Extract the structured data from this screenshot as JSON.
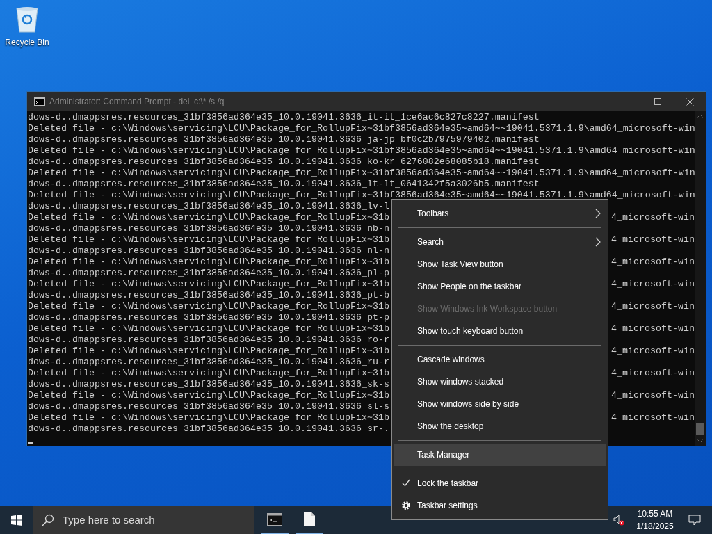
{
  "desktop_icons": [
    {
      "label": "Recycle Bin"
    }
  ],
  "window": {
    "title": "Administrator: Command Prompt - del  c:\\* /s /q",
    "active": false,
    "lines": [
      {
        "text": "dows-d..dmappsres.resources_31bf3856ad364e35_10.0.19041.3636_it-it_1ce6ac6c827c8227.manifest"
      },
      {
        "text": "Deleted file - c:\\Windows\\servicing\\LCU\\Package_for_RollupFix~31bf3856ad364e35~amd64~~19041.5371.1.9\\amd64_microsoft-win"
      },
      {
        "text": "dows-d..dmappsres.resources_31bf3856ad364e35_10.0.19041.3636_ja-jp_bf0c2b7975979402.manifest"
      },
      {
        "text": "Deleted file - c:\\Windows\\servicing\\LCU\\Package_for_RollupFix~31bf3856ad364e35~amd64~~19041.5371.1.9\\amd64_microsoft-win"
      },
      {
        "text": "dows-d..dmappsres.resources_31bf3856ad364e35_10.0.19041.3636_ko-kr_6276082e68085b18.manifest"
      },
      {
        "text": "Deleted file - c:\\Windows\\servicing\\LCU\\Package_for_RollupFix~31bf3856ad364e35~amd64~~19041.5371.1.9\\amd64_microsoft-win"
      },
      {
        "text": "dows-d..dmappsres.resources_31bf3856ad364e35_10.0.19041.3636_lt-lt_0641342f5a3026b5.manifest"
      },
      {
        "text": "Deleted file - c:\\Windows\\servicing\\LCU\\Package_for_RollupFix~31bf3856ad364e35~amd64~~19041.5371.1.9\\amd64_microsoft-win"
      },
      {
        "text": "dows-d..dmappsres.resources_31bf3856ad364e35_10.0.19041.3636_lv-l"
      },
      {
        "text": "Deleted file - c:\\Windows\\servicing\\LCU\\Package_for_RollupFix~31b",
        "tail": "4_microsoft-win"
      },
      {
        "text": "dows-d..dmappsres.resources_31bf3856ad364e35_10.0.19041.3636_nb-n"
      },
      {
        "text": "Deleted file - c:\\Windows\\servicing\\LCU\\Package_for_RollupFix~31b",
        "tail": "4_microsoft-win"
      },
      {
        "text": "dows-d..dmappsres.resources_31bf3856ad364e35_10.0.19041.3636_nl-n"
      },
      {
        "text": "Deleted file - c:\\Windows\\servicing\\LCU\\Package_for_RollupFix~31b",
        "tail": "4_microsoft-win"
      },
      {
        "text": "dows-d..dmappsres.resources_31bf3856ad364e35_10.0.19041.3636_pl-p"
      },
      {
        "text": "Deleted file - c:\\Windows\\servicing\\LCU\\Package_for_RollupFix~31b",
        "tail": "4_microsoft-win"
      },
      {
        "text": "dows-d..dmappsres.resources_31bf3856ad364e35_10.0.19041.3636_pt-b"
      },
      {
        "text": "Deleted file - c:\\Windows\\servicing\\LCU\\Package_for_RollupFix~31b",
        "tail": "4_microsoft-win"
      },
      {
        "text": "dows-d..dmappsres.resources_31bf3856ad364e35_10.0.19041.3636_pt-p"
      },
      {
        "text": "Deleted file - c:\\Windows\\servicing\\LCU\\Package_for_RollupFix~31b",
        "tail": "4_microsoft-win"
      },
      {
        "text": "dows-d..dmappsres.resources_31bf3856ad364e35_10.0.19041.3636_ro-r"
      },
      {
        "text": "Deleted file - c:\\Windows\\servicing\\LCU\\Package_for_RollupFix~31b",
        "tail": "4_microsoft-win"
      },
      {
        "text": "dows-d..dmappsres.resources_31bf3856ad364e35_10.0.19041.3636_ru-r"
      },
      {
        "text": "Deleted file - c:\\Windows\\servicing\\LCU\\Package_for_RollupFix~31b",
        "tail": "4_microsoft-win"
      },
      {
        "text": "dows-d..dmappsres.resources_31bf3856ad364e35_10.0.19041.3636_sk-s"
      },
      {
        "text": "Deleted file - c:\\Windows\\servicing\\LCU\\Package_for_RollupFix~31b",
        "tail": "4_microsoft-win"
      },
      {
        "text": "dows-d..dmappsres.resources_31bf3856ad364e35_10.0.19041.3636_sl-s"
      },
      {
        "text": "Deleted file - c:\\Windows\\servicing\\LCU\\Package_for_RollupFix~31b",
        "tail": "4_microsoft-win"
      },
      {
        "text": "dows-d..dmappsres.resources_31bf3856ad364e35_10.0.19041.3636_sr-."
      }
    ]
  },
  "context_menu": {
    "items": [
      {
        "kind": "item",
        "label": "Toolbars",
        "submenu": true,
        "disabled": false,
        "selected": false,
        "checked": false
      },
      {
        "kind": "separator"
      },
      {
        "kind": "item",
        "label": "Search",
        "submenu": true,
        "disabled": false,
        "selected": false,
        "checked": false
      },
      {
        "kind": "item",
        "label": "Show Task View button",
        "submenu": false,
        "disabled": false,
        "selected": false,
        "checked": false
      },
      {
        "kind": "item",
        "label": "Show People on the taskbar",
        "submenu": false,
        "disabled": false,
        "selected": false,
        "checked": false
      },
      {
        "kind": "item",
        "label": "Show Windows Ink Workspace button",
        "submenu": false,
        "disabled": true,
        "selected": false,
        "checked": false
      },
      {
        "kind": "item",
        "label": "Show touch keyboard button",
        "submenu": false,
        "disabled": false,
        "selected": false,
        "checked": false
      },
      {
        "kind": "separator"
      },
      {
        "kind": "item",
        "label": "Cascade windows",
        "submenu": false,
        "disabled": false,
        "selected": false,
        "checked": false
      },
      {
        "kind": "item",
        "label": "Show windows stacked",
        "submenu": false,
        "disabled": false,
        "selected": false,
        "checked": false
      },
      {
        "kind": "item",
        "label": "Show windows side by side",
        "submenu": false,
        "disabled": false,
        "selected": false,
        "checked": false
      },
      {
        "kind": "item",
        "label": "Show the desktop",
        "submenu": false,
        "disabled": false,
        "selected": false,
        "checked": false
      },
      {
        "kind": "separator"
      },
      {
        "kind": "item",
        "label": "Task Manager",
        "submenu": false,
        "disabled": false,
        "selected": true,
        "checked": false
      },
      {
        "kind": "separator"
      },
      {
        "kind": "item",
        "label": "Lock the taskbar",
        "submenu": false,
        "disabled": false,
        "selected": false,
        "checked": true
      },
      {
        "kind": "settings",
        "label": "Taskbar settings",
        "submenu": false,
        "disabled": false,
        "selected": false,
        "checked": false
      }
    ]
  },
  "taskbar": {
    "search": {
      "placeholder": "Type here to search"
    },
    "clock": {
      "time": "10:55 AM",
      "date": "1/18/2025"
    }
  }
}
